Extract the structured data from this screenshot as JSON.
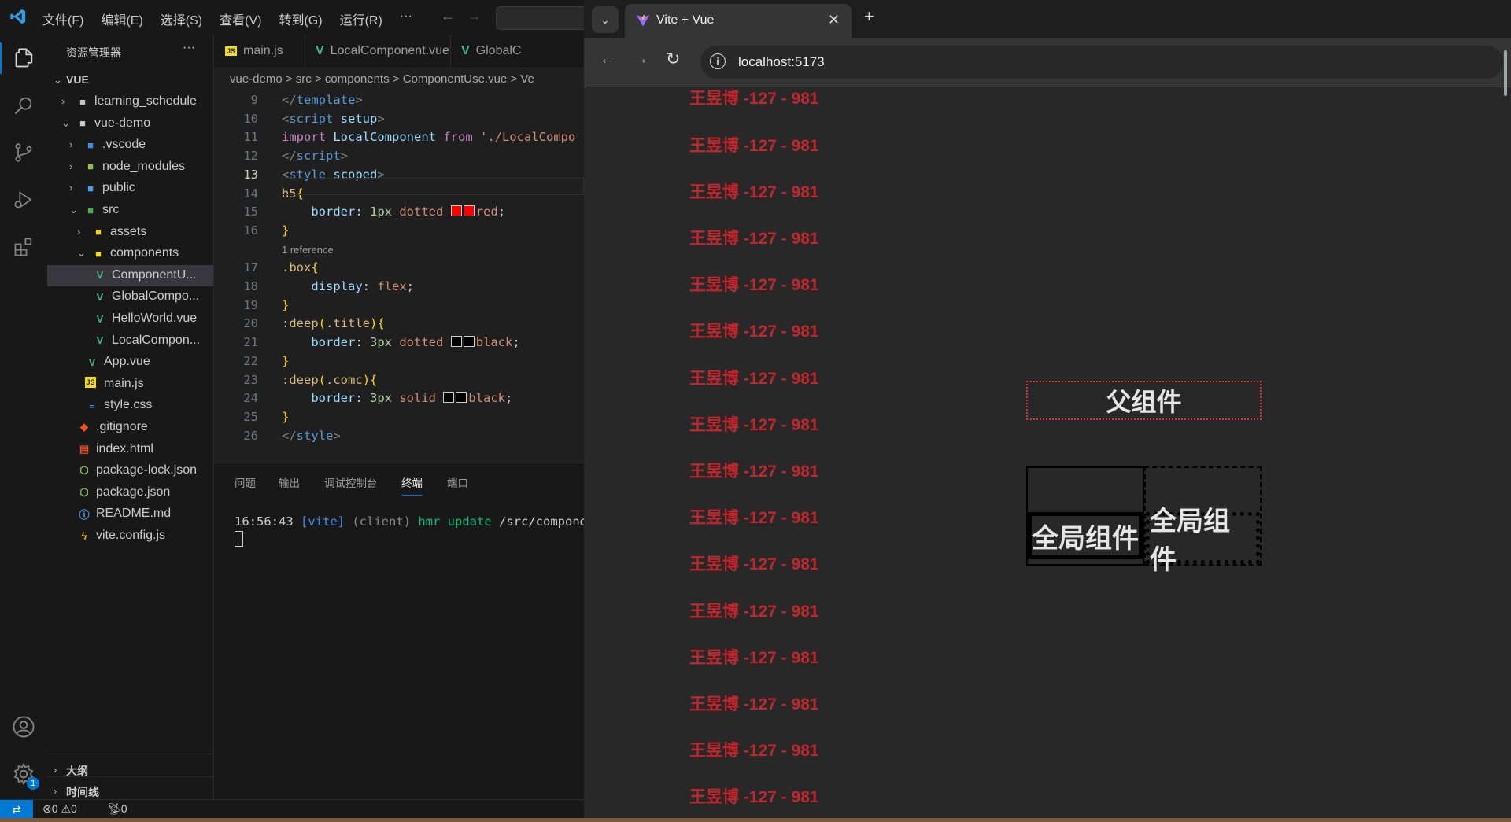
{
  "vscode": {
    "menu": [
      "文件(F)",
      "编辑(E)",
      "选择(S)",
      "查看(V)",
      "转到(G)",
      "运行(R)",
      "···"
    ],
    "explorer_title": "资源管理器",
    "explorer_more": "···",
    "workspace": "VUE",
    "tree": [
      {
        "label": "learning_schedule",
        "chevron": "›",
        "icon": "folder-icon",
        "color": "#c5c5c5"
      },
      {
        "label": "vue-demo",
        "chevron": "⌄",
        "icon": "folder-open-icon",
        "color": "#c5c5c5"
      },
      {
        "label": ".vscode",
        "chevron": "›",
        "icon": "vscode-folder-icon",
        "color": "#3b8eea"
      },
      {
        "label": "node_modules",
        "chevron": "›",
        "icon": "node-folder-icon",
        "color": "#8bc34a"
      },
      {
        "label": "public",
        "chevron": "›",
        "icon": "public-folder-icon",
        "color": "#42a5f5"
      },
      {
        "label": "src",
        "chevron": "⌄",
        "icon": "src-folder-icon",
        "color": "#4caf50"
      },
      {
        "label": "assets",
        "chevron": "›",
        "icon": "assets-folder-icon",
        "color": "#ffca28"
      },
      {
        "label": "components",
        "chevron": "⌄",
        "icon": "components-folder-icon",
        "color": "#fdd835"
      },
      {
        "label": "ComponentU...",
        "chevron": "",
        "icon": "vue-file-icon",
        "color": "#41b883"
      },
      {
        "label": "GlobalCompo...",
        "chevron": "",
        "icon": "vue-file-icon",
        "color": "#41b883"
      },
      {
        "label": "HelloWorld.vue",
        "chevron": "",
        "icon": "vue-file-icon",
        "color": "#41b883"
      },
      {
        "label": "LocalCompon...",
        "chevron": "",
        "icon": "vue-file-icon",
        "color": "#41b883"
      },
      {
        "label": "App.vue",
        "chevron": "",
        "icon": "vue-file-icon",
        "color": "#41b883"
      },
      {
        "label": "main.js",
        "chevron": "",
        "icon": "js-file-icon",
        "color": "#f5de19"
      },
      {
        "label": "style.css",
        "chevron": "",
        "icon": "css-file-icon",
        "color": "#42a5f5"
      },
      {
        "label": ".gitignore",
        "chevron": "",
        "icon": "git-file-icon",
        "color": "#f4511e"
      },
      {
        "label": "index.html",
        "chevron": "",
        "icon": "html-file-icon",
        "color": "#e44d26"
      },
      {
        "label": "package-lock.json",
        "chevron": "",
        "icon": "npm-file-icon",
        "color": "#8bc34a"
      },
      {
        "label": "package.json",
        "chevron": "",
        "icon": "npm-file-icon",
        "color": "#8bc34a"
      },
      {
        "label": "README.md",
        "chevron": "",
        "icon": "info-file-icon",
        "color": "#42a5f5"
      },
      {
        "label": "vite.config.js",
        "chevron": "",
        "icon": "vite-file-icon",
        "color": "#ffc107"
      }
    ],
    "outline": "大纲",
    "timeline": "时间线",
    "tabs": [
      {
        "label": "main.js",
        "icon": "js-file-icon"
      },
      {
        "label": "LocalComponent.vue",
        "icon": "vue-file-icon"
      },
      {
        "label": "GlobalC",
        "icon": "vue-file-icon"
      }
    ],
    "breadcrumb": "vue-demo > src > components > ComponentUse.vue > Ve",
    "code_lines": [
      {
        "n": "9",
        "html": "<span style='color:#808080'>&lt;/</span><span style='color:#569cd6'>template</span><span style='color:#808080'>&gt;</span>"
      },
      {
        "n": "10",
        "html": "<span style='color:#808080'>&lt;</span><span style='color:#569cd6'>script</span> <span style='color:#9cdcfe'>setup</span><span style='color:#808080'>&gt;</span>"
      },
      {
        "n": "11",
        "html": "<span style='color:#c586c0'>import</span> <span style='color:#9cdcfe'>LocalComponent</span> <span style='color:#c586c0'>from</span> <span style='color:#ce9178'>'./LocalCompo</span>"
      },
      {
        "n": "12",
        "html": "<span style='color:#808080'>&lt;/</span><span style='color:#569cd6'>script</span><span style='color:#808080'>&gt;</span>"
      },
      {
        "n": "13",
        "html": "<span style='color:#808080'>&lt;</span><span style='color:#569cd6'>style</span> <span style='color:#9cdcfe'>scoped</span><span style='color:#808080'>&gt;</span>"
      },
      {
        "n": "14",
        "html": "<span style='color:#d7ba7d'>h5</span><span style='color:#ffd700'>{</span>"
      },
      {
        "n": "15",
        "html": "    <span style='color:#9cdcfe'>border</span>: <span style='color:#b5cea8'>1px</span> <span style='color:#ce9178'>dotted</span> <span class='sw' style='background:#f00'></span><span class='sw' style='background:#f00'></span><span style='color:#ce9178'>red</span>;"
      },
      {
        "n": "16",
        "html": "<span style='color:#ffd700'>}</span>"
      },
      {
        "n": "",
        "html": "<span style='color:#999;font-family:Liberation Sans,sans-serif;font-size:13px'>1 reference</span>"
      },
      {
        "n": "17",
        "html": "<span style='color:#d7ba7d'>.box</span><span style='color:#ffd700'>{</span>"
      },
      {
        "n": "18",
        "html": "    <span style='color:#9cdcfe'>display</span>: <span style='color:#ce9178'>flex</span>;"
      },
      {
        "n": "19",
        "html": "<span style='color:#ffd700'>}</span>"
      },
      {
        "n": "20",
        "html": "<span style='color:#d7ba7d'>:deep</span><span style='color:#ffd700'>(</span><span style='color:#d7ba7d'>.title</span><span style='color:#ffd700'>){</span>"
      },
      {
        "n": "21",
        "html": "    <span style='color:#9cdcfe'>border</span>: <span style='color:#b5cea8'>3px</span> <span style='color:#ce9178'>dotted</span> <span class='sw' style='background:#000'></span><span class='sw' style='background:#000'></span><span style='color:#ce9178'>black</span>;"
      },
      {
        "n": "22",
        "html": "<span style='color:#ffd700'>}</span>"
      },
      {
        "n": "23",
        "html": "<span style='color:#d7ba7d'>:deep</span><span style='color:#ffd700'>(</span><span style='color:#d7ba7d'>.comc</span><span style='color:#ffd700'>){</span>"
      },
      {
        "n": "24",
        "html": "    <span style='color:#9cdcfe'>border</span>: <span style='color:#b5cea8'>3px</span> <span style='color:#ce9178'>solid</span> <span class='sw' style='background:#000'></span><span class='sw' style='background:#000'></span><span style='color:#ce9178'>black</span>;"
      },
      {
        "n": "25",
        "html": "<span style='color:#ffd700'>}</span>"
      },
      {
        "n": "26",
        "html": "<span style='color:#808080'>&lt;/</span><span style='color:#569cd6'>style</span><span style='color:#808080'>&gt;</span>"
      }
    ],
    "panel_tabs": [
      "问题",
      "输出",
      "调试控制台",
      "终端",
      "端口"
    ],
    "terminal": {
      "time": "16:56:43",
      "tag": "[vite]",
      "client": "(client)",
      "hmr": "hmr update",
      "path": "/src/componen"
    },
    "status": {
      "errors": "0",
      "warnings": "0",
      "ports": "0",
      "gear_badge": "1"
    }
  },
  "browser": {
    "tab_title": "Vite + Vue",
    "url": "localhost:5173",
    "repeated_text": "王昱博 -127 - 981",
    "repeat_count": 19,
    "parent_label": "父组件",
    "global_label_1": "全局组件",
    "global_label_2": "全局组件"
  }
}
